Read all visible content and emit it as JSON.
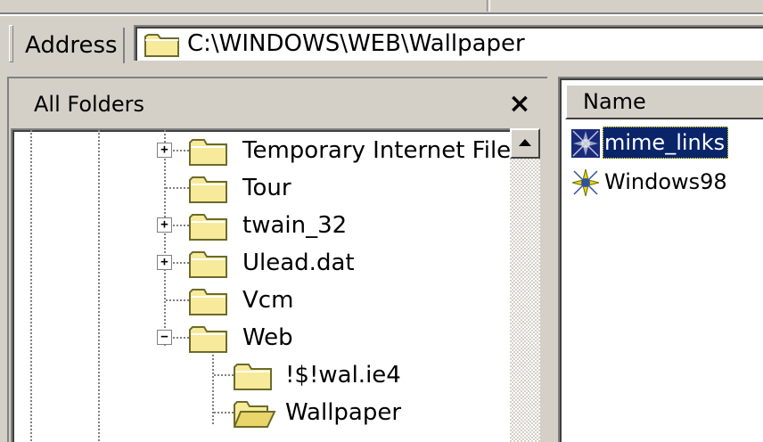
{
  "address": {
    "label": "Address",
    "path": "C:\\WINDOWS\\WEB\\Wallpaper"
  },
  "folders_pane": {
    "title": "All Folders",
    "close_glyph": "×",
    "tree": [
      {
        "label": "Temporary Internet Files",
        "expander": "+",
        "icon": "folder-closed-icon"
      },
      {
        "label": "Tour",
        "expander": "",
        "icon": "folder-closed-icon"
      },
      {
        "label": "twain_32",
        "expander": "+",
        "icon": "folder-closed-icon"
      },
      {
        "label": "Ulead.dat",
        "expander": "+",
        "icon": "folder-closed-icon"
      },
      {
        "label": "Vcm",
        "expander": "",
        "icon": "folder-closed-icon"
      },
      {
        "label": "Web",
        "expander": "−",
        "icon": "folder-closed-icon"
      },
      {
        "label": "!$!wal.ie4",
        "expander": "",
        "icon": "folder-closed-icon"
      },
      {
        "label": "Wallpaper",
        "expander": "",
        "icon": "folder-open-icon"
      }
    ]
  },
  "file_list": {
    "column_name": "Name",
    "items": [
      {
        "label": "mime_links",
        "selected": true,
        "icon": "web-document-icon"
      },
      {
        "label": "Windows98",
        "selected": false,
        "icon": "web-document-icon"
      }
    ]
  },
  "colors": {
    "face": "#d4d0c8",
    "selection": "#0a246a",
    "folder": "#f5e58c"
  }
}
